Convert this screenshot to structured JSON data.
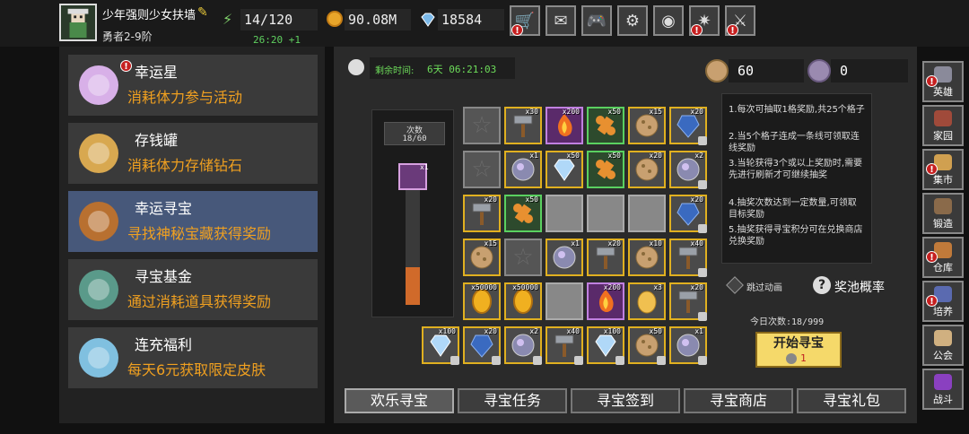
{
  "header": {
    "player_name": "少年强则少女扶墙",
    "player_level": "勇者2-9阶",
    "stamina": "14/120",
    "stamina_timer": "26:20 +1",
    "gold": "90.08M",
    "gems": "18584",
    "buttons": [
      {
        "name": "shop-cart",
        "icon": "🛒",
        "badge": true
      },
      {
        "name": "mail",
        "icon": "✉",
        "badge": false
      },
      {
        "name": "gamepad",
        "icon": "🎮",
        "badge": false
      },
      {
        "name": "settings",
        "icon": "⚙",
        "badge": false
      },
      {
        "name": "color-wheel",
        "icon": "◉",
        "badge": false
      },
      {
        "name": "fireworks",
        "icon": "✷",
        "badge": true
      },
      {
        "name": "crossed-swords",
        "icon": "⚔",
        "badge": true
      }
    ]
  },
  "sidebar": {
    "items": [
      {
        "title": "幸运星",
        "desc": "消耗体力参与活动",
        "active": false,
        "badge": true
      },
      {
        "title": "存钱罐",
        "desc": "消耗体力存储钻石",
        "active": false,
        "badge": false
      },
      {
        "title": "幸运寻宝",
        "desc": "寻找神秘宝藏获得奖励",
        "active": true,
        "badge": false
      },
      {
        "title": "寻宝基金",
        "desc": "通过消耗道具获得奖励",
        "active": false,
        "badge": false
      },
      {
        "title": "连充福利",
        "desc": "每天6元获取限定皮肤",
        "active": false,
        "badge": false
      }
    ]
  },
  "event": {
    "timer_label": "剩余时间:",
    "timer_value": "6天 06:21:03",
    "currency_a": "60",
    "currency_b": "0"
  },
  "counter": {
    "label": "次数",
    "value": "18/60",
    "milestone_qty": "x1",
    "progress": 0.3
  },
  "grid": {
    "rows": [
      [
        {
          "item": "empty"
        },
        {
          "item": "hammer",
          "qty": "x30",
          "tier": "rare"
        },
        {
          "item": "fire",
          "qty": "x200",
          "tier": "epic"
        },
        {
          "item": "bone",
          "qty": "x50",
          "tier": "green"
        },
        {
          "item": "cookie",
          "qty": "x15",
          "tier": "rare"
        },
        {
          "item": "blue-gem",
          "qty": "x20",
          "tier": "rare",
          "lock": true
        }
      ],
      [
        {
          "item": "empty"
        },
        {
          "item": "orb",
          "qty": "x1",
          "tier": "rare"
        },
        {
          "item": "diamond",
          "qty": "x50",
          "tier": "rare"
        },
        {
          "item": "bone",
          "qty": "x50",
          "tier": "green"
        },
        {
          "item": "cookie",
          "qty": "x20",
          "tier": "rare"
        },
        {
          "item": "orb",
          "qty": "x2",
          "tier": "rare",
          "lock": true
        }
      ],
      [
        {
          "item": "hammer",
          "qty": "x20",
          "tier": "rare"
        },
        {
          "item": "bone",
          "qty": "x50",
          "tier": "green"
        },
        {
          "item": "gray"
        },
        {
          "item": "gray"
        },
        {
          "item": "gray"
        },
        {
          "item": "blue-gem",
          "qty": "x20",
          "tier": "rare",
          "lock": true
        }
      ],
      [
        {
          "item": "cookie",
          "qty": "x15",
          "tier": "rare"
        },
        {
          "item": "empty"
        },
        {
          "item": "orb",
          "qty": "x1",
          "tier": "rare"
        },
        {
          "item": "hammer",
          "qty": "x20",
          "tier": "rare"
        },
        {
          "item": "cookie",
          "qty": "x10",
          "tier": "rare"
        },
        {
          "item": "hammer",
          "qty": "x40",
          "tier": "rare",
          "lock": true
        }
      ],
      [
        {
          "item": "coin",
          "qty": "x50000",
          "tier": "rare"
        },
        {
          "item": "coin",
          "qty": "x50000",
          "tier": "rare"
        },
        {
          "item": "gray"
        },
        {
          "item": "fire",
          "qty": "x200",
          "tier": "epic"
        },
        {
          "item": "egg",
          "qty": "x3",
          "tier": "rare"
        },
        {
          "item": "hammer",
          "qty": "x20",
          "tier": "rare",
          "lock": true
        }
      ]
    ],
    "bottom_row": [
      {
        "item": "diamond",
        "qty": "x100",
        "tier": "rare",
        "lock": true
      },
      {
        "item": "blue-gem",
        "qty": "x20",
        "tier": "rare",
        "lock": true
      },
      {
        "item": "orb",
        "qty": "x2",
        "tier": "rare",
        "lock": true
      },
      {
        "item": "hammer",
        "qty": "x40",
        "tier": "rare",
        "lock": true
      },
      {
        "item": "diamond",
        "qty": "x100",
        "tier": "rare",
        "lock": true
      },
      {
        "item": "cookie",
        "qty": "x50",
        "tier": "rare",
        "lock": true
      },
      {
        "item": "orb",
        "qty": "x1",
        "tier": "rare",
        "lock": true
      }
    ]
  },
  "rules": [
    "1.每次可抽取1格奖励,共25个格子",
    "2.当5个格子连成一条线可领取连线奖励",
    "3.当轮获得3个或以上奖励时,需要先进行刷新才可继续抽奖",
    "4.抽奖次数达到一定数量,可领取目标奖励",
    "5.抽奖获得寻宝积分可在兑换商店兑换奖励"
  ],
  "controls": {
    "skip_animation": "跳过动画",
    "pool_rate": "奖池概率",
    "today_count": "今日次数:18/999",
    "start_button": "开始寻宝",
    "start_cost": "1"
  },
  "tabs": [
    {
      "label": "欢乐寻宝",
      "active": true
    },
    {
      "label": "寻宝任务",
      "active": false
    },
    {
      "label": "寻宝签到",
      "active": false
    },
    {
      "label": "寻宝商店",
      "active": false
    },
    {
      "label": "寻宝礼包",
      "active": false
    }
  ],
  "right_nav": [
    {
      "label": "英雄",
      "badge": true
    },
    {
      "label": "家园",
      "badge": false
    },
    {
      "label": "集市",
      "badge": true
    },
    {
      "label": "锻造",
      "badge": false
    },
    {
      "label": "仓库",
      "badge": true
    },
    {
      "label": "培养",
      "badge": true
    },
    {
      "label": "公会",
      "badge": false
    },
    {
      "label": "战斗",
      "badge": false
    }
  ],
  "colors": {
    "accent_orange": "#f0a020",
    "timer_green": "#6ddc5a",
    "active_menu": "#47587a",
    "start_button": "#f5d96a"
  }
}
